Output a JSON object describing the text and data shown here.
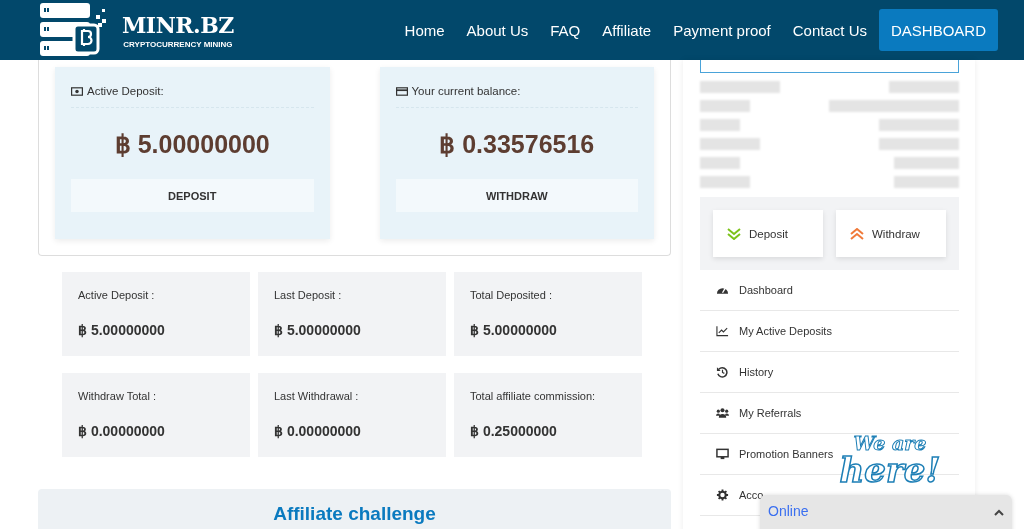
{
  "header": {
    "logo": {
      "name": "MINR.BZ",
      "tagline": "CRYPTOCURRENCY MINING"
    },
    "nav": [
      {
        "label": "Home"
      },
      {
        "label": "About Us"
      },
      {
        "label": "FAQ"
      },
      {
        "label": "Affiliate"
      },
      {
        "label": "Payment proof"
      },
      {
        "label": "Contact Us"
      }
    ],
    "dashboard_button": "DASHBOARD"
  },
  "balances": [
    {
      "kind": "deposit",
      "label": "Active Deposit:",
      "amount": "฿ 5.00000000",
      "button": "DEPOSIT"
    },
    {
      "kind": "balance",
      "label": "Your current balance:",
      "amount": "฿ 0.33576516",
      "button": "WITHDRAW"
    }
  ],
  "stats": [
    {
      "label": "Active Deposit :",
      "value": "฿ 5.00000000"
    },
    {
      "label": "Last Deposit :",
      "value": "฿ 5.00000000"
    },
    {
      "label": "Total Deposited :",
      "value": "฿ 5.00000000"
    },
    {
      "label": "Withdraw Total :",
      "value": "฿ 0.00000000"
    },
    {
      "label": "Last Withdrawal :",
      "value": "฿ 0.00000000"
    },
    {
      "label": "Total affiliate commission:",
      "value": "฿ 0.25000000"
    }
  ],
  "affiliate": {
    "title": "Affiliate challenge"
  },
  "sidebar": {
    "actions": [
      {
        "kind": "deposit",
        "label": "Deposit"
      },
      {
        "kind": "withdraw",
        "label": "Withdraw"
      }
    ],
    "menu": [
      {
        "kind": "dashboard",
        "label": "Dashboard"
      },
      {
        "kind": "deposits",
        "label": "My Active Deposits"
      },
      {
        "kind": "history",
        "label": "History"
      },
      {
        "kind": "referrals",
        "label": "My Referrals"
      },
      {
        "kind": "banners",
        "label": "Promotion Banners"
      },
      {
        "kind": "account",
        "label": "Acco"
      }
    ]
  },
  "chat": {
    "sticker": [
      "We are",
      "here!"
    ],
    "status": "Online"
  }
}
